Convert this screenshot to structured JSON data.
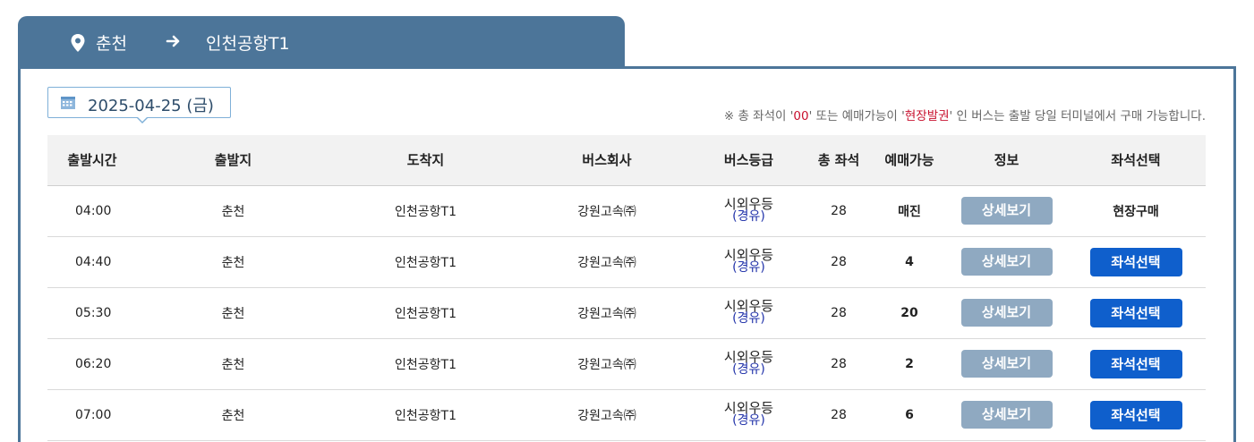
{
  "route": {
    "origin": "춘천",
    "destination": "인천공항T1",
    "pin_icon": "location-pin-icon",
    "arrow_icon": "arrow-right-icon"
  },
  "date": {
    "value": "2025-04-25 (금)",
    "icon": "calendar-icon"
  },
  "notice": {
    "part1": "※ 총 좌석이 '",
    "highlight1": "00",
    "part2": "' 또는 예매가능이 '",
    "highlight2": "현장발권",
    "part3": "' 인 버스는 출발 당일 터미널에서 구매 가능합니다."
  },
  "colors": {
    "header_bar": "#4c7599",
    "detail_button": "#8fa9c1",
    "seat_button": "#0f5fcc",
    "notice_highlight": "#c8102e",
    "via_text": "#2233aa"
  },
  "table": {
    "headers": {
      "departure_time": "출발시간",
      "origin": "출발지",
      "destination": "도착지",
      "company": "버스회사",
      "grade": "버스등급",
      "total_seats": "총 좌석",
      "available": "예매가능",
      "info": "정보",
      "seat_select": "좌석선택"
    },
    "rows": [
      {
        "time": "04:00",
        "origin": "춘천",
        "destination": "인천공항T1",
        "company": "강원고속㈜",
        "grade": "시외우등",
        "via": "(경유)",
        "total": "28",
        "available": "매진",
        "detail": "상세보기",
        "action": "현장구매"
      },
      {
        "time": "04:40",
        "origin": "춘천",
        "destination": "인천공항T1",
        "company": "강원고속㈜",
        "grade": "시외우등",
        "via": "(경유)",
        "total": "28",
        "available": "4",
        "detail": "상세보기",
        "action": "좌석선택"
      },
      {
        "time": "05:30",
        "origin": "춘천",
        "destination": "인천공항T1",
        "company": "강원고속㈜",
        "grade": "시외우등",
        "via": "(경유)",
        "total": "28",
        "available": "20",
        "detail": "상세보기",
        "action": "좌석선택"
      },
      {
        "time": "06:20",
        "origin": "춘천",
        "destination": "인천공항T1",
        "company": "강원고속㈜",
        "grade": "시외우등",
        "via": "(경유)",
        "total": "28",
        "available": "2",
        "detail": "상세보기",
        "action": "좌석선택"
      },
      {
        "time": "07:00",
        "origin": "춘천",
        "destination": "인천공항T1",
        "company": "강원고속㈜",
        "grade": "시외우등",
        "via": "(경유)",
        "total": "28",
        "available": "6",
        "detail": "상세보기",
        "action": "좌석선택"
      }
    ]
  }
}
